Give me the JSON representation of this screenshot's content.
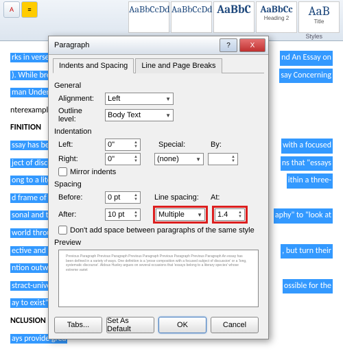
{
  "ribbon": {
    "styles": [
      {
        "sample": "AaBbCcDd",
        "label": ""
      },
      {
        "sample": "AaBbCcDd",
        "label": ""
      },
      {
        "sample": "AaBbC",
        "label": ""
      },
      {
        "sample": "AaBbCc",
        "label": "Heading 2"
      },
      {
        "sample": "AaB",
        "label": "Title"
      }
    ],
    "group_label": "Styles"
  },
  "doc": {
    "l1a": "rks in verse have",
    "l1b": "nd An Essay on",
    "l2a": "). While brevity",
    "l2b": "say Concerning",
    "l3": "man Understandi",
    "l4": "nterexamples.",
    "h1": "FINITION",
    "l5a": "ssay has been d",
    "l5b": "with a focused",
    "l6a": "ject of discussi",
    "l6b": "ns that \"essays",
    "l7a": "ong to a literary",
    "l7b": "ithin a three-",
    "l8": "d frame of refe",
    "l9a": "sonal and the a",
    "l9b": "aphy\" to \"look at",
    "l10": "world through t",
    "l11a": "ective and factu",
    "l11b": ", but turn their",
    "l12": "ntion outward t",
    "l13a": "stract-universal:",
    "l13b": "ossible for the",
    "l14": "ay to exist\". Thi",
    "h2": "NCLUSION",
    "l15": "ays provide grea"
  },
  "dialog": {
    "title": "Paragraph",
    "help": "?",
    "close": "X",
    "tabs": {
      "t1": "Indents and Spacing",
      "t2": "Line and Page Breaks"
    },
    "general": {
      "label": "General",
      "alignment": {
        "label": "Alignment:",
        "value": "Left"
      },
      "outline": {
        "label": "Outline level:",
        "value": "Body Text"
      }
    },
    "indent": {
      "label": "Indentation",
      "left": {
        "label": "Left:",
        "value": "0\""
      },
      "right": {
        "label": "Right:",
        "value": "0\""
      },
      "special": {
        "label": "Special:",
        "value": "(none)"
      },
      "by": {
        "label": "By:",
        "value": ""
      },
      "mirror": "Mirror indents"
    },
    "spacing": {
      "label": "Spacing",
      "before": {
        "label": "Before:",
        "value": "0 pt"
      },
      "after": {
        "label": "After:",
        "value": "10 pt"
      },
      "line": {
        "label": "Line spacing:",
        "value": "Multiple"
      },
      "at": {
        "label": "At:",
        "value": "1.4"
      },
      "dont_add": "Don't add space between paragraphs of the same style"
    },
    "preview": {
      "label": "Preview",
      "text": "Previous Paragraph Previous Paragraph Previous Paragraph Previous Paragraph Previous Paragraph    An essay has been defined in a variety of ways. One definition is a 'prose composition with a focused subject of discussion' or a 'long, systematic discourse'. Aldous Huxley argues on several occasions that 'essays belong to a literary species'    whose extreme variet"
    },
    "buttons": {
      "tabs": "Tabs...",
      "default": "Set As Default",
      "ok": "OK",
      "cancel": "Cancel"
    }
  }
}
